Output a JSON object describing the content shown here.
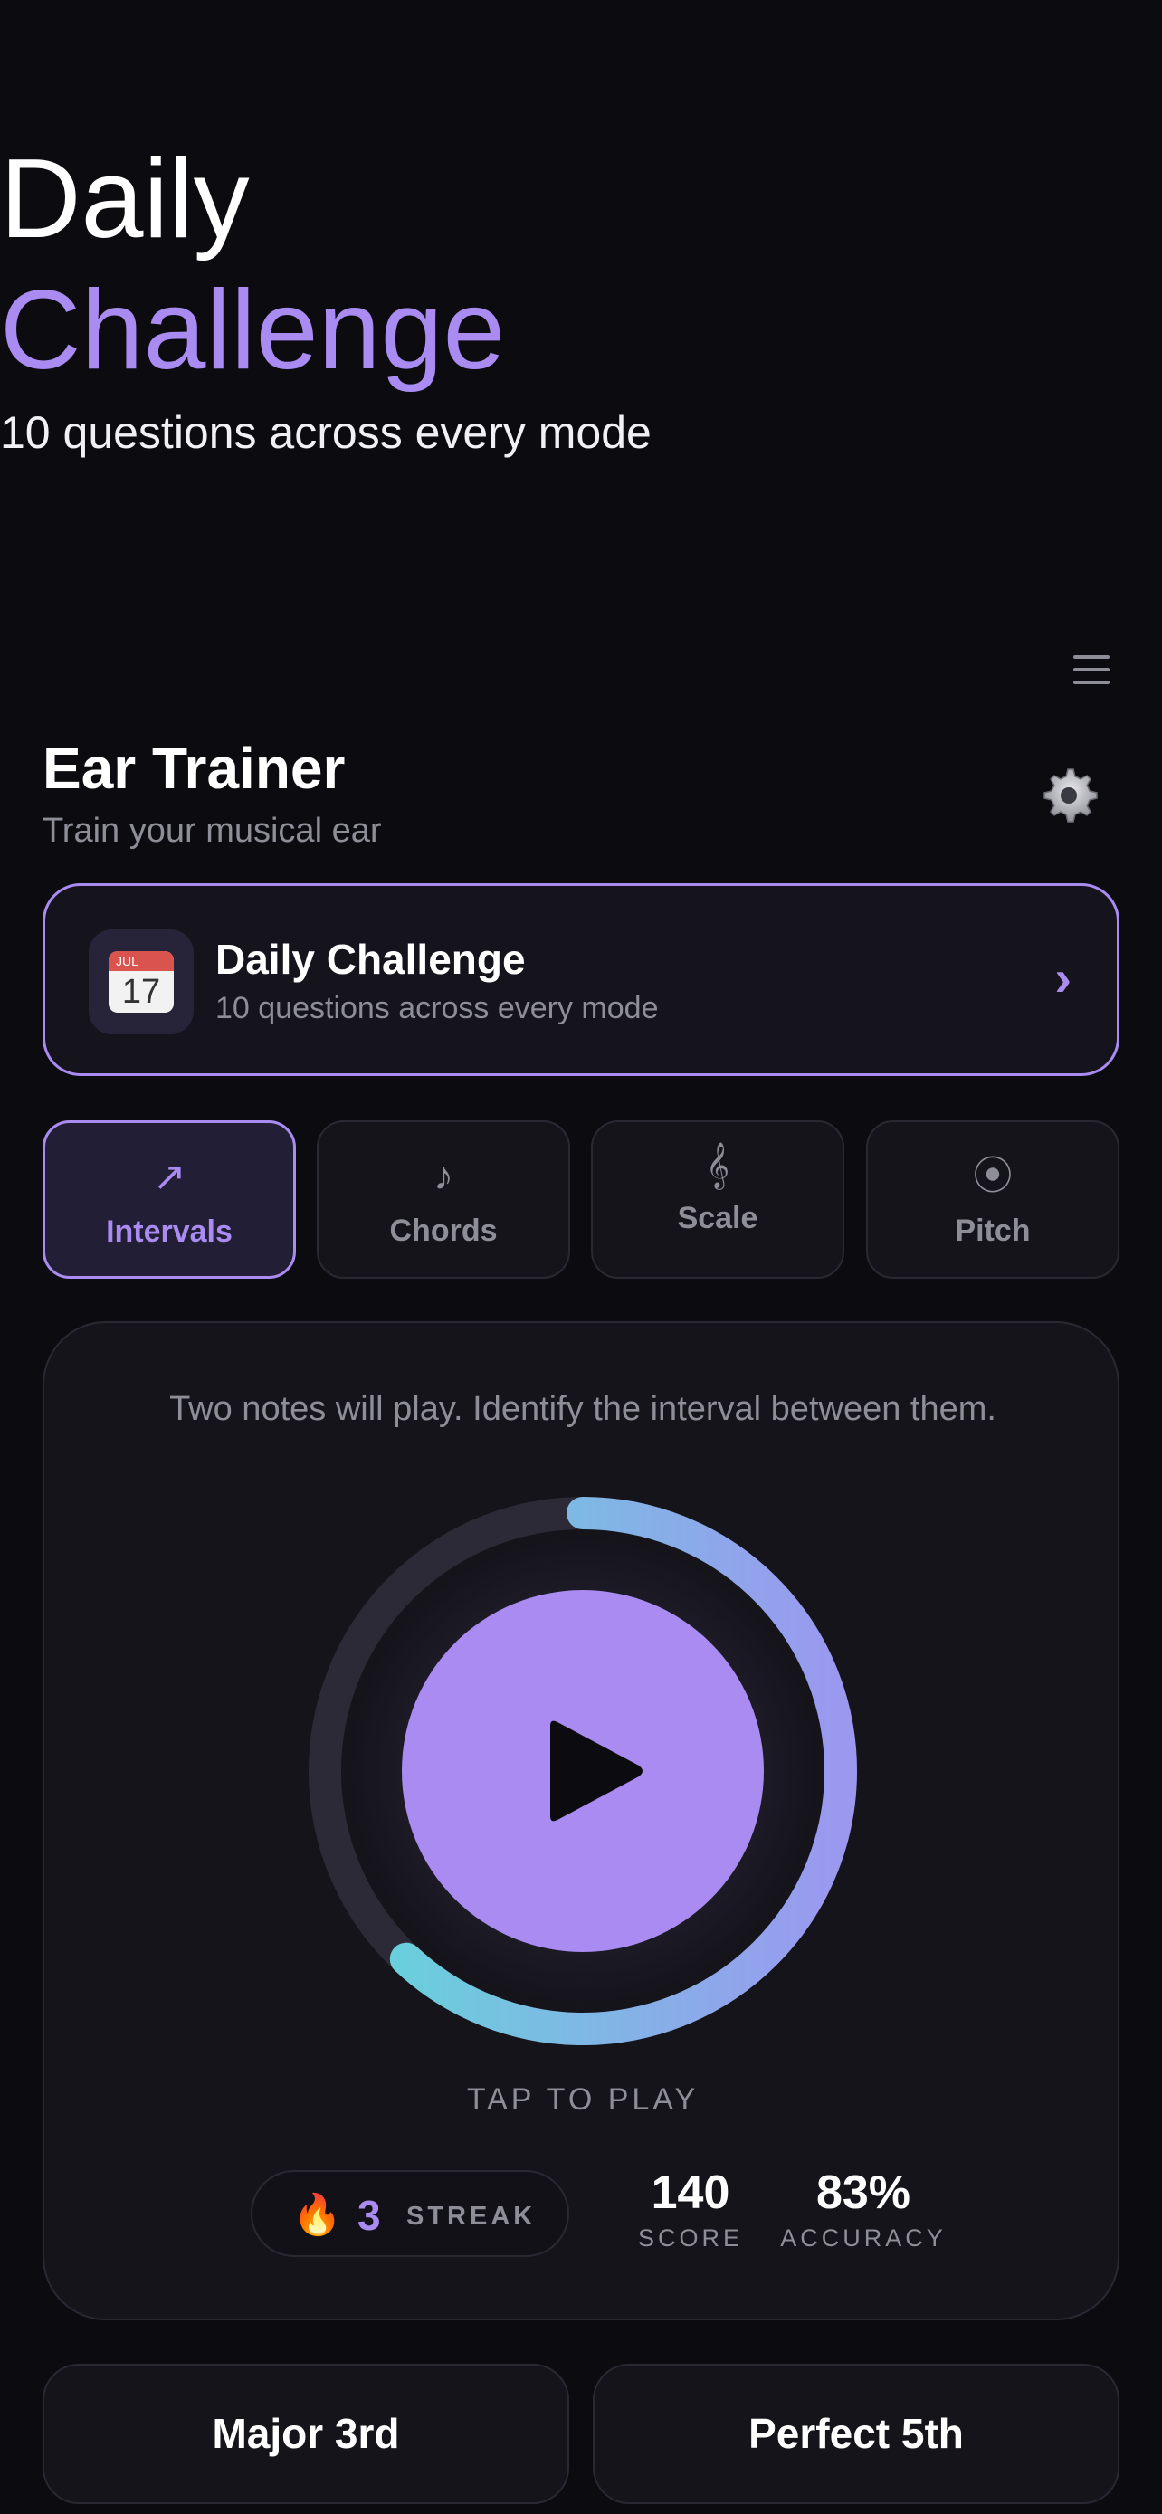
{
  "hero": {
    "line1": "Daily",
    "line2": "Challenge",
    "subtitle": "10 questions across every mode"
  },
  "header": {
    "title": "Ear Trainer",
    "subtitle": "Train your musical ear"
  },
  "daily_card": {
    "icon_month": "JUL",
    "icon_day": "17",
    "title": "Daily Challenge",
    "subtitle": "10 questions across every mode",
    "chevron": "›"
  },
  "modes": [
    {
      "label": "Intervals",
      "icon": "↗",
      "icon_name": "arrow-up-right-icon",
      "active": true
    },
    {
      "label": "Chords",
      "icon": "♪",
      "icon_name": "music-note-icon",
      "active": false
    },
    {
      "label": "Scale",
      "icon": "𝄞",
      "icon_name": "treble-clef-icon",
      "active": false
    },
    {
      "label": "Pitch",
      "icon": "⦿",
      "icon_name": "target-icon",
      "active": false
    }
  ],
  "play_card": {
    "instruction": "Two notes will play. Identify the interval between them.",
    "tap_label": "TAP TO PLAY",
    "progress": 0.62
  },
  "stats": {
    "streak_value": "3",
    "streak_label": "STREAK",
    "score_value": "140",
    "score_label": "SCORE",
    "accuracy_value": "83%",
    "accuracy_label": "ACCURACY"
  },
  "answers": [
    {
      "label": "Major 3rd"
    },
    {
      "label": "Perfect 5th"
    }
  ],
  "colors": {
    "accent": "#a98bf2",
    "ring_start": "#62d8d8",
    "ring_end": "#9b98f0",
    "background": "#0c0c10",
    "muted": "#8e8e98"
  }
}
